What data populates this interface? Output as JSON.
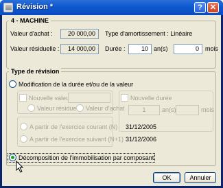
{
  "window": {
    "title": "Révision *",
    "help": "?",
    "close": "✕"
  },
  "asset_group": {
    "title": "4 - MACHINE",
    "purchase_value_label": "Valeur d'achat :",
    "purchase_value": "20 000,00",
    "residual_value_label": "Valeur résiduelle :",
    "residual_value": "14 000,00",
    "depreciation_type": "Type d'amortissement :  Linéaire",
    "duration_label": "Durée :",
    "duration_years": "10",
    "years_unit": "an(s)",
    "duration_months": "0",
    "months_unit": "mois"
  },
  "revision_group": {
    "title": "Type de révision",
    "option_modify": "Modification de la durée et/ou de la valeur",
    "new_value_label": "Nouvelle valeur",
    "new_value": "",
    "radio_residual": "Valeur résiduelle",
    "radio_purchase": "Valeur d'achat",
    "new_duration_label": "Nouvelle durée",
    "new_duration_years": "1",
    "years_unit": "an(s)",
    "new_duration_months": "",
    "months_unit": "mois",
    "from_current_label": "A partir de l'exercice courant (N)",
    "from_current_date": "31/12/2005",
    "from_next_label": "A partir de l'exercice suivant (N+1)",
    "from_next_date": "31/12/2006",
    "option_decompose": "Décomposition de l'immobilisation par composant"
  },
  "footer": {
    "ok": "OK",
    "cancel": "Annuler"
  },
  "colors": {
    "title_bar": "#0e58d0",
    "dialog_bg": "#ece9d8",
    "radio_selected": "#21a121"
  }
}
